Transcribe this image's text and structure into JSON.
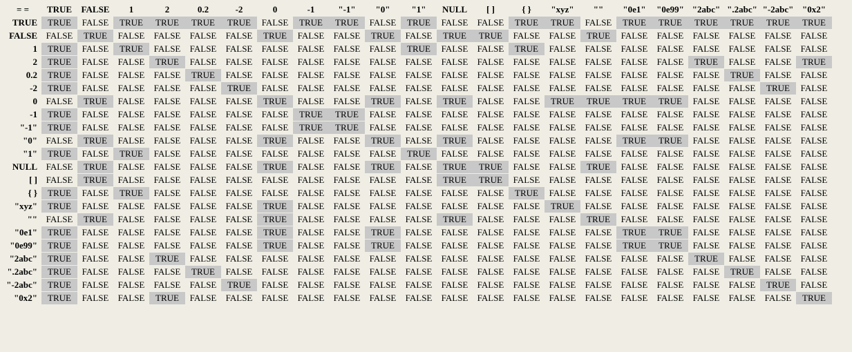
{
  "corner": "= =",
  "headers": [
    "TRUE",
    "FALSE",
    "1",
    "2",
    "0.2",
    "-2",
    "0",
    "-1",
    "\"-1\"",
    "\"0\"",
    "\"1\"",
    "NULL",
    "[ ]",
    "{ }",
    "\"xyz\"",
    "\"\"",
    "\"0e1\"",
    "\"0e99\"",
    "\"2abc\"",
    "\".2abc\"",
    "\"-2abc\"",
    "\"0x2\""
  ],
  "rows": [
    {
      "label": "TRUE",
      "cells": [
        "TRUE",
        "FALSE",
        "TRUE",
        "TRUE",
        "TRUE",
        "TRUE",
        "FALSE",
        "TRUE",
        "TRUE",
        "FALSE",
        "TRUE",
        "FALSE",
        "FALSE",
        "TRUE",
        "TRUE",
        "FALSE",
        "TRUE",
        "TRUE",
        "TRUE",
        "TRUE",
        "TRUE",
        "TRUE"
      ]
    },
    {
      "label": "FALSE",
      "cells": [
        "FALSE",
        "TRUE",
        "FALSE",
        "FALSE",
        "FALSE",
        "FALSE",
        "TRUE",
        "FALSE",
        "FALSE",
        "TRUE",
        "FALSE",
        "TRUE",
        "TRUE",
        "FALSE",
        "FALSE",
        "TRUE",
        "FALSE",
        "FALSE",
        "FALSE",
        "FALSE",
        "FALSE",
        "FALSE"
      ]
    },
    {
      "label": "1",
      "cells": [
        "TRUE",
        "FALSE",
        "TRUE",
        "FALSE",
        "FALSE",
        "FALSE",
        "FALSE",
        "FALSE",
        "FALSE",
        "FALSE",
        "TRUE",
        "FALSE",
        "FALSE",
        "TRUE",
        "FALSE",
        "FALSE",
        "FALSE",
        "FALSE",
        "FALSE",
        "FALSE",
        "FALSE",
        "FALSE"
      ]
    },
    {
      "label": "2",
      "cells": [
        "TRUE",
        "FALSE",
        "FALSE",
        "TRUE",
        "FALSE",
        "FALSE",
        "FALSE",
        "FALSE",
        "FALSE",
        "FALSE",
        "FALSE",
        "FALSE",
        "FALSE",
        "FALSE",
        "FALSE",
        "FALSE",
        "FALSE",
        "FALSE",
        "TRUE",
        "FALSE",
        "FALSE",
        "TRUE"
      ]
    },
    {
      "label": "0.2",
      "cells": [
        "TRUE",
        "FALSE",
        "FALSE",
        "FALSE",
        "TRUE",
        "FALSE",
        "FALSE",
        "FALSE",
        "FALSE",
        "FALSE",
        "FALSE",
        "FALSE",
        "FALSE",
        "FALSE",
        "FALSE",
        "FALSE",
        "FALSE",
        "FALSE",
        "FALSE",
        "TRUE",
        "FALSE",
        "FALSE"
      ]
    },
    {
      "label": "-2",
      "cells": [
        "TRUE",
        "FALSE",
        "FALSE",
        "FALSE",
        "FALSE",
        "TRUE",
        "FALSE",
        "FALSE",
        "FALSE",
        "FALSE",
        "FALSE",
        "FALSE",
        "FALSE",
        "FALSE",
        "FALSE",
        "FALSE",
        "FALSE",
        "FALSE",
        "FALSE",
        "FALSE",
        "TRUE",
        "FALSE"
      ]
    },
    {
      "label": "0",
      "cells": [
        "FALSE",
        "TRUE",
        "FALSE",
        "FALSE",
        "FALSE",
        "FALSE",
        "TRUE",
        "FALSE",
        "FALSE",
        "TRUE",
        "FALSE",
        "TRUE",
        "FALSE",
        "FALSE",
        "TRUE",
        "TRUE",
        "TRUE",
        "TRUE",
        "FALSE",
        "FALSE",
        "FALSE",
        "FALSE"
      ]
    },
    {
      "label": "-1",
      "cells": [
        "TRUE",
        "FALSE",
        "FALSE",
        "FALSE",
        "FALSE",
        "FALSE",
        "FALSE",
        "TRUE",
        "TRUE",
        "FALSE",
        "FALSE",
        "FALSE",
        "FALSE",
        "FALSE",
        "FALSE",
        "FALSE",
        "FALSE",
        "FALSE",
        "FALSE",
        "FALSE",
        "FALSE",
        "FALSE"
      ]
    },
    {
      "label": "\"-1\"",
      "cells": [
        "TRUE",
        "FALSE",
        "FALSE",
        "FALSE",
        "FALSE",
        "FALSE",
        "FALSE",
        "TRUE",
        "TRUE",
        "FALSE",
        "FALSE",
        "FALSE",
        "FALSE",
        "FALSE",
        "FALSE",
        "FALSE",
        "FALSE",
        "FALSE",
        "FALSE",
        "FALSE",
        "FALSE",
        "FALSE"
      ]
    },
    {
      "label": "\"0\"",
      "cells": [
        "FALSE",
        "TRUE",
        "FALSE",
        "FALSE",
        "FALSE",
        "FALSE",
        "TRUE",
        "FALSE",
        "FALSE",
        "TRUE",
        "FALSE",
        "TRUE",
        "FALSE",
        "FALSE",
        "FALSE",
        "FALSE",
        "TRUE",
        "TRUE",
        "FALSE",
        "FALSE",
        "FALSE",
        "FALSE"
      ]
    },
    {
      "label": "\"1\"",
      "cells": [
        "TRUE",
        "FALSE",
        "TRUE",
        "FALSE",
        "FALSE",
        "FALSE",
        "FALSE",
        "FALSE",
        "FALSE",
        "FALSE",
        "TRUE",
        "FALSE",
        "FALSE",
        "FALSE",
        "FALSE",
        "FALSE",
        "FALSE",
        "FALSE",
        "FALSE",
        "FALSE",
        "FALSE",
        "FALSE"
      ]
    },
    {
      "label": "NULL",
      "cells": [
        "FALSE",
        "TRUE",
        "FALSE",
        "FALSE",
        "FALSE",
        "FALSE",
        "TRUE",
        "FALSE",
        "FALSE",
        "TRUE",
        "FALSE",
        "TRUE",
        "TRUE",
        "FALSE",
        "FALSE",
        "TRUE",
        "FALSE",
        "FALSE",
        "FALSE",
        "FALSE",
        "FALSE",
        "FALSE"
      ]
    },
    {
      "label": "[ ]",
      "cells": [
        "FALSE",
        "TRUE",
        "FALSE",
        "FALSE",
        "FALSE",
        "FALSE",
        "FALSE",
        "FALSE",
        "FALSE",
        "FALSE",
        "FALSE",
        "TRUE",
        "TRUE",
        "FALSE",
        "FALSE",
        "FALSE",
        "FALSE",
        "FALSE",
        "FALSE",
        "FALSE",
        "FALSE",
        "FALSE"
      ]
    },
    {
      "label": "{ }",
      "cells": [
        "TRUE",
        "FALSE",
        "TRUE",
        "FALSE",
        "FALSE",
        "FALSE",
        "FALSE",
        "FALSE",
        "FALSE",
        "FALSE",
        "FALSE",
        "FALSE",
        "FALSE",
        "TRUE",
        "FALSE",
        "FALSE",
        "FALSE",
        "FALSE",
        "FALSE",
        "FALSE",
        "FALSE",
        "FALSE"
      ]
    },
    {
      "label": "\"xyz\"",
      "cells": [
        "TRUE",
        "FALSE",
        "FALSE",
        "FALSE",
        "FALSE",
        "FALSE",
        "TRUE",
        "FALSE",
        "FALSE",
        "FALSE",
        "FALSE",
        "FALSE",
        "FALSE",
        "FALSE",
        "TRUE",
        "FALSE",
        "FALSE",
        "FALSE",
        "FALSE",
        "FALSE",
        "FALSE",
        "FALSE"
      ]
    },
    {
      "label": "\"\"",
      "cells": [
        "FALSE",
        "TRUE",
        "FALSE",
        "FALSE",
        "FALSE",
        "FALSE",
        "TRUE",
        "FALSE",
        "FALSE",
        "FALSE",
        "FALSE",
        "TRUE",
        "FALSE",
        "FALSE",
        "FALSE",
        "TRUE",
        "FALSE",
        "FALSE",
        "FALSE",
        "FALSE",
        "FALSE",
        "FALSE"
      ]
    },
    {
      "label": "\"0e1\"",
      "cells": [
        "TRUE",
        "FALSE",
        "FALSE",
        "FALSE",
        "FALSE",
        "FALSE",
        "TRUE",
        "FALSE",
        "FALSE",
        "TRUE",
        "FALSE",
        "FALSE",
        "FALSE",
        "FALSE",
        "FALSE",
        "FALSE",
        "TRUE",
        "TRUE",
        "FALSE",
        "FALSE",
        "FALSE",
        "FALSE"
      ]
    },
    {
      "label": "\"0e99\"",
      "cells": [
        "TRUE",
        "FALSE",
        "FALSE",
        "FALSE",
        "FALSE",
        "FALSE",
        "TRUE",
        "FALSE",
        "FALSE",
        "TRUE",
        "FALSE",
        "FALSE",
        "FALSE",
        "FALSE",
        "FALSE",
        "FALSE",
        "TRUE",
        "TRUE",
        "FALSE",
        "FALSE",
        "FALSE",
        "FALSE"
      ]
    },
    {
      "label": "\"2abc\"",
      "cells": [
        "TRUE",
        "FALSE",
        "FALSE",
        "TRUE",
        "FALSE",
        "FALSE",
        "FALSE",
        "FALSE",
        "FALSE",
        "FALSE",
        "FALSE",
        "FALSE",
        "FALSE",
        "FALSE",
        "FALSE",
        "FALSE",
        "FALSE",
        "FALSE",
        "TRUE",
        "FALSE",
        "FALSE",
        "FALSE"
      ]
    },
    {
      "label": "\".2abc\"",
      "cells": [
        "TRUE",
        "FALSE",
        "FALSE",
        "FALSE",
        "TRUE",
        "FALSE",
        "FALSE",
        "FALSE",
        "FALSE",
        "FALSE",
        "FALSE",
        "FALSE",
        "FALSE",
        "FALSE",
        "FALSE",
        "FALSE",
        "FALSE",
        "FALSE",
        "FALSE",
        "TRUE",
        "FALSE",
        "FALSE"
      ]
    },
    {
      "label": "\"-2abc\"",
      "cells": [
        "TRUE",
        "FALSE",
        "FALSE",
        "FALSE",
        "FALSE",
        "TRUE",
        "FALSE",
        "FALSE",
        "FALSE",
        "FALSE",
        "FALSE",
        "FALSE",
        "FALSE",
        "FALSE",
        "FALSE",
        "FALSE",
        "FALSE",
        "FALSE",
        "FALSE",
        "FALSE",
        "TRUE",
        "FALSE"
      ]
    },
    {
      "label": "\"0x2\"",
      "cells": [
        "TRUE",
        "FALSE",
        "FALSE",
        "TRUE",
        "FALSE",
        "FALSE",
        "FALSE",
        "FALSE",
        "FALSE",
        "FALSE",
        "FALSE",
        "FALSE",
        "FALSE",
        "FALSE",
        "FALSE",
        "FALSE",
        "FALSE",
        "FALSE",
        "FALSE",
        "FALSE",
        "FALSE",
        "TRUE"
      ]
    }
  ]
}
